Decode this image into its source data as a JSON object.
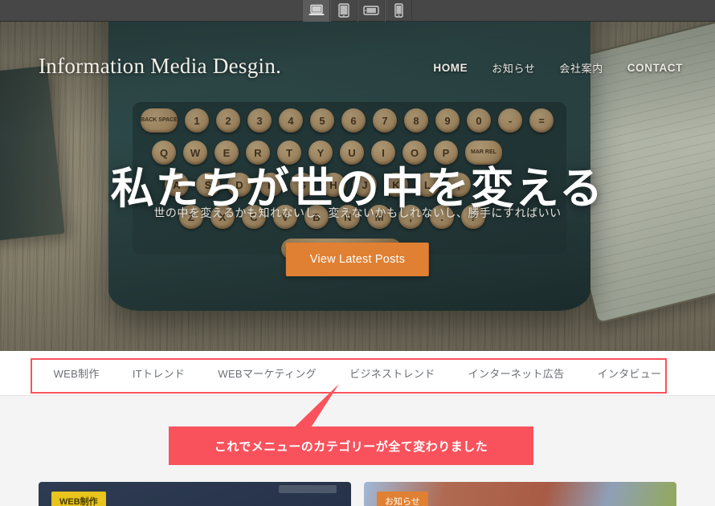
{
  "device_bar": {
    "buttons": [
      {
        "name": "desktop-view",
        "icon": "laptop-icon",
        "active": true
      },
      {
        "name": "tablet-portrait-view",
        "icon": "tablet-portrait-icon",
        "active": false
      },
      {
        "name": "tablet-landscape-view",
        "icon": "tablet-landscape-icon",
        "active": false
      },
      {
        "name": "mobile-view",
        "icon": "mobile-icon",
        "active": false
      }
    ]
  },
  "site": {
    "brand": "Information Media Desgin.",
    "nav": [
      {
        "label": "HOME"
      },
      {
        "label": "お知らせ"
      },
      {
        "label": "会社案内"
      },
      {
        "label": "CONTACT"
      }
    ],
    "hero": {
      "headline": "私たちが世の中を変える",
      "subtitle": "世の中を変えるかも知れないし、変えないかもしれないし、勝手にすればいい",
      "cta_label": "View Latest Posts",
      "cta_color": "#e08033"
    },
    "categories": [
      {
        "label": "WEB制作"
      },
      {
        "label": "ITトレンド"
      },
      {
        "label": "WEBマーケティング"
      },
      {
        "label": "ビジネストレンド"
      },
      {
        "label": "インターネット広告"
      },
      {
        "label": "インタビュー"
      }
    ],
    "cards": [
      {
        "badge": "WEB制作",
        "badge_color": "#e8c41c",
        "style": "dark"
      },
      {
        "badge": "お知らせ",
        "badge_color": "#e08033",
        "style": "photo"
      }
    ]
  },
  "annotation": {
    "text": "これでメニューのカテゴリーが全て変わりました",
    "color": "#f9525c",
    "highlight_color": "#f9525c"
  },
  "typewriter": {
    "row1": [
      "Q",
      "W",
      "E",
      "R",
      "T",
      "Y",
      "U",
      "I",
      "O",
      "P"
    ],
    "row2": [
      "A",
      "S",
      "D",
      "F",
      "G",
      "H",
      "J",
      "K",
      "L",
      ";"
    ],
    "row3": [
      "Z",
      "X",
      "C",
      "V",
      "B",
      "N",
      "M",
      ",",
      ".",
      "?"
    ],
    "row0": [
      "1",
      "2",
      "3",
      "4",
      "5",
      "6",
      "7",
      "8",
      "9",
      "0",
      "-",
      "="
    ],
    "left_key": "BACK SPACE",
    "right_key": "MAR REL"
  }
}
